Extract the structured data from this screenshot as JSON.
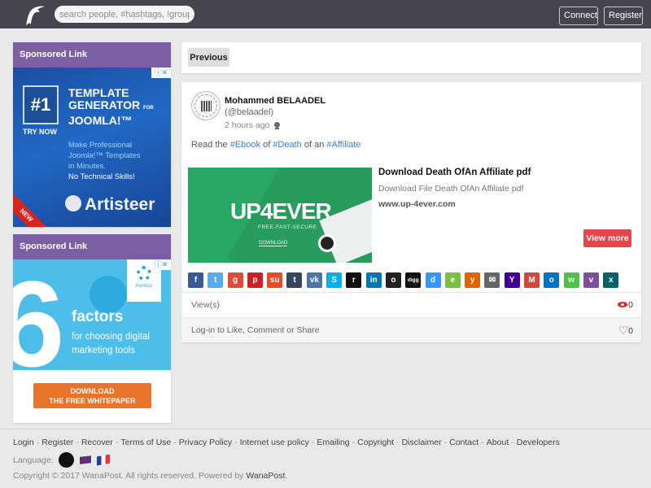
{
  "header": {
    "logo": "dolphin-logo",
    "search_placeholder": "search people, #hashtags, !groups",
    "connect_label": "Connect",
    "register_label": "Register"
  },
  "sidebar": {
    "ads": [
      {
        "heading": "Sponsored Link",
        "badge": "#1",
        "try_now": "TRY NOW",
        "title_lines": [
          "TEMPLATE",
          "GENERATOR",
          "JOOMLA!™"
        ],
        "title_for": "FOR",
        "body_lines": [
          "Make Professional",
          "Joomla!™ Templates",
          "in Minutes."
        ],
        "tagline": "No Technical Skills!",
        "brand": "Artisteer",
        "corner_flag": "NEW"
      },
      {
        "heading": "Sponsored Link",
        "big_number": "6",
        "brand": "Kentico",
        "headline": "factors",
        "body_lines": [
          "for choosing digital",
          "marketing tools"
        ],
        "cta_lines": [
          "DOWNLOAD",
          "THE FREE WHITEPAPER"
        ]
      }
    ]
  },
  "main": {
    "previous_label": "Previous",
    "post": {
      "author": "Mohammed BELAADEL",
      "handle": "(@belaadel)",
      "time": "2 hours ago",
      "visibility_icon": "public-globe-icon",
      "text_parts": [
        "Read the ",
        "#Ebook",
        " of ",
        "#Death",
        " of an ",
        "#Affiliate"
      ],
      "link": {
        "image_brand": "UP4EVER",
        "image_tagline": "FREE-FAST-SECURE",
        "image_download": "DOWNLOAD",
        "title": "Download Death OfAn Affiliate pdf",
        "description": "Download File Death OfAn Affiliate pdf",
        "domain": "www.up-4ever.com",
        "view_more_label": "View more"
      },
      "share_buttons": [
        {
          "name": "facebook",
          "glyph": "f",
          "color": "#3b5998"
        },
        {
          "name": "twitter",
          "glyph": "t",
          "color": "#55acee"
        },
        {
          "name": "google-plus",
          "glyph": "g",
          "color": "#dd4b39"
        },
        {
          "name": "pinterest",
          "glyph": "p",
          "color": "#cb2027"
        },
        {
          "name": "stumbleupon",
          "glyph": "su",
          "color": "#eb4924"
        },
        {
          "name": "tumblr",
          "glyph": "t",
          "color": "#35465c"
        },
        {
          "name": "vk",
          "glyph": "vk",
          "color": "#4c75a3"
        },
        {
          "name": "skype",
          "glyph": "S",
          "color": "#00aff0"
        },
        {
          "name": "reddit",
          "glyph": "r",
          "color": "#111111"
        },
        {
          "name": "linkedin",
          "glyph": "in",
          "color": "#0077b5"
        },
        {
          "name": "myspace",
          "glyph": "o",
          "color": "#222222"
        },
        {
          "name": "digg",
          "glyph": "digg",
          "color": "#111111"
        },
        {
          "name": "delicious",
          "glyph": "d",
          "color": "#3399ff"
        },
        {
          "name": "evernote",
          "glyph": "e",
          "color": "#7ac142"
        },
        {
          "name": "yummly",
          "glyph": "y",
          "color": "#e26300"
        },
        {
          "name": "email",
          "glyph": "✉",
          "color": "#666666"
        },
        {
          "name": "yahoo",
          "glyph": "Y",
          "color": "#410093"
        },
        {
          "name": "gmail",
          "glyph": "M",
          "color": "#d44638"
        },
        {
          "name": "outlook",
          "glyph": "o",
          "color": "#0072c6"
        },
        {
          "name": "whatsapp",
          "glyph": "w",
          "color": "#4dc247"
        },
        {
          "name": "viber",
          "glyph": "v",
          "color": "#7b519d"
        },
        {
          "name": "xing",
          "glyph": "x",
          "color": "#026466"
        }
      ],
      "views_label": "View(s)",
      "views_count": "0",
      "login_prompt": "Log-in to Like, Comment or Share",
      "likes_count": "0"
    }
  },
  "footer": {
    "links": [
      "Login",
      "Register",
      "Recover",
      "Terms of Use",
      "Privacy Policy",
      "Internet use policy",
      "Emailing",
      "Copyright",
      "Disclaimer",
      "Contact",
      "About",
      "Developers"
    ],
    "language_label": "Language:",
    "languages": [
      "default",
      "English",
      "Français"
    ],
    "copyright_prefix": "Copyright © 2017 WanaPost. All rights reserved. Powered by ",
    "copyright_brand": "WanaPost",
    "copyright_suffix": "."
  }
}
